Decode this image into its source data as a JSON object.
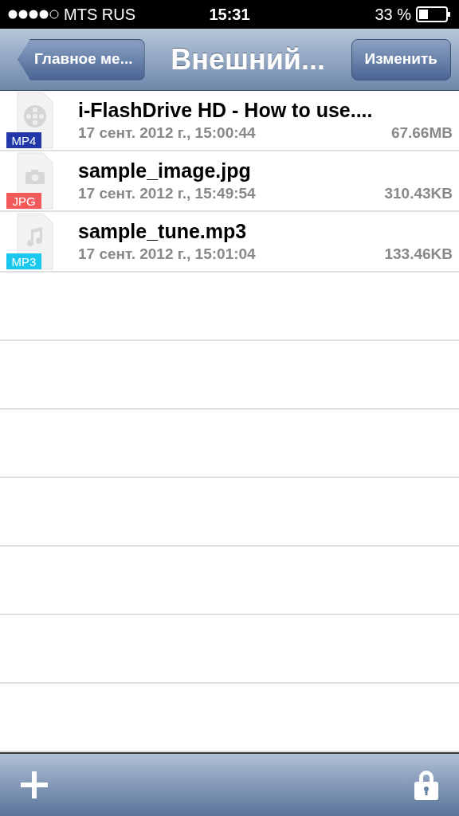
{
  "status_bar": {
    "carrier": "MTS RUS",
    "time": "15:31",
    "battery": "33 %"
  },
  "nav_bar": {
    "back": "Главное ме...",
    "title": "Внешний...",
    "edit": "Изменить"
  },
  "files": [
    {
      "name": "i-FlashDrive HD - How to use....",
      "date": "17 сент. 2012 г., 15:00:44",
      "size": "67.66MB",
      "kind": "video",
      "badge": "MP4",
      "color": "#2237a8"
    },
    {
      "name": "sample_image.jpg",
      "date": "17 сент. 2012 г., 15:49:54",
      "size": "310.43KB",
      "kind": "photo",
      "badge": "JPG",
      "color": "#f45a5a"
    },
    {
      "name": "sample_tune.mp3",
      "date": "17 сент. 2012 г., 15:01:04",
      "size": "133.46KB",
      "kind": "music",
      "badge": "MP3",
      "color": "#19c8ec"
    }
  ]
}
